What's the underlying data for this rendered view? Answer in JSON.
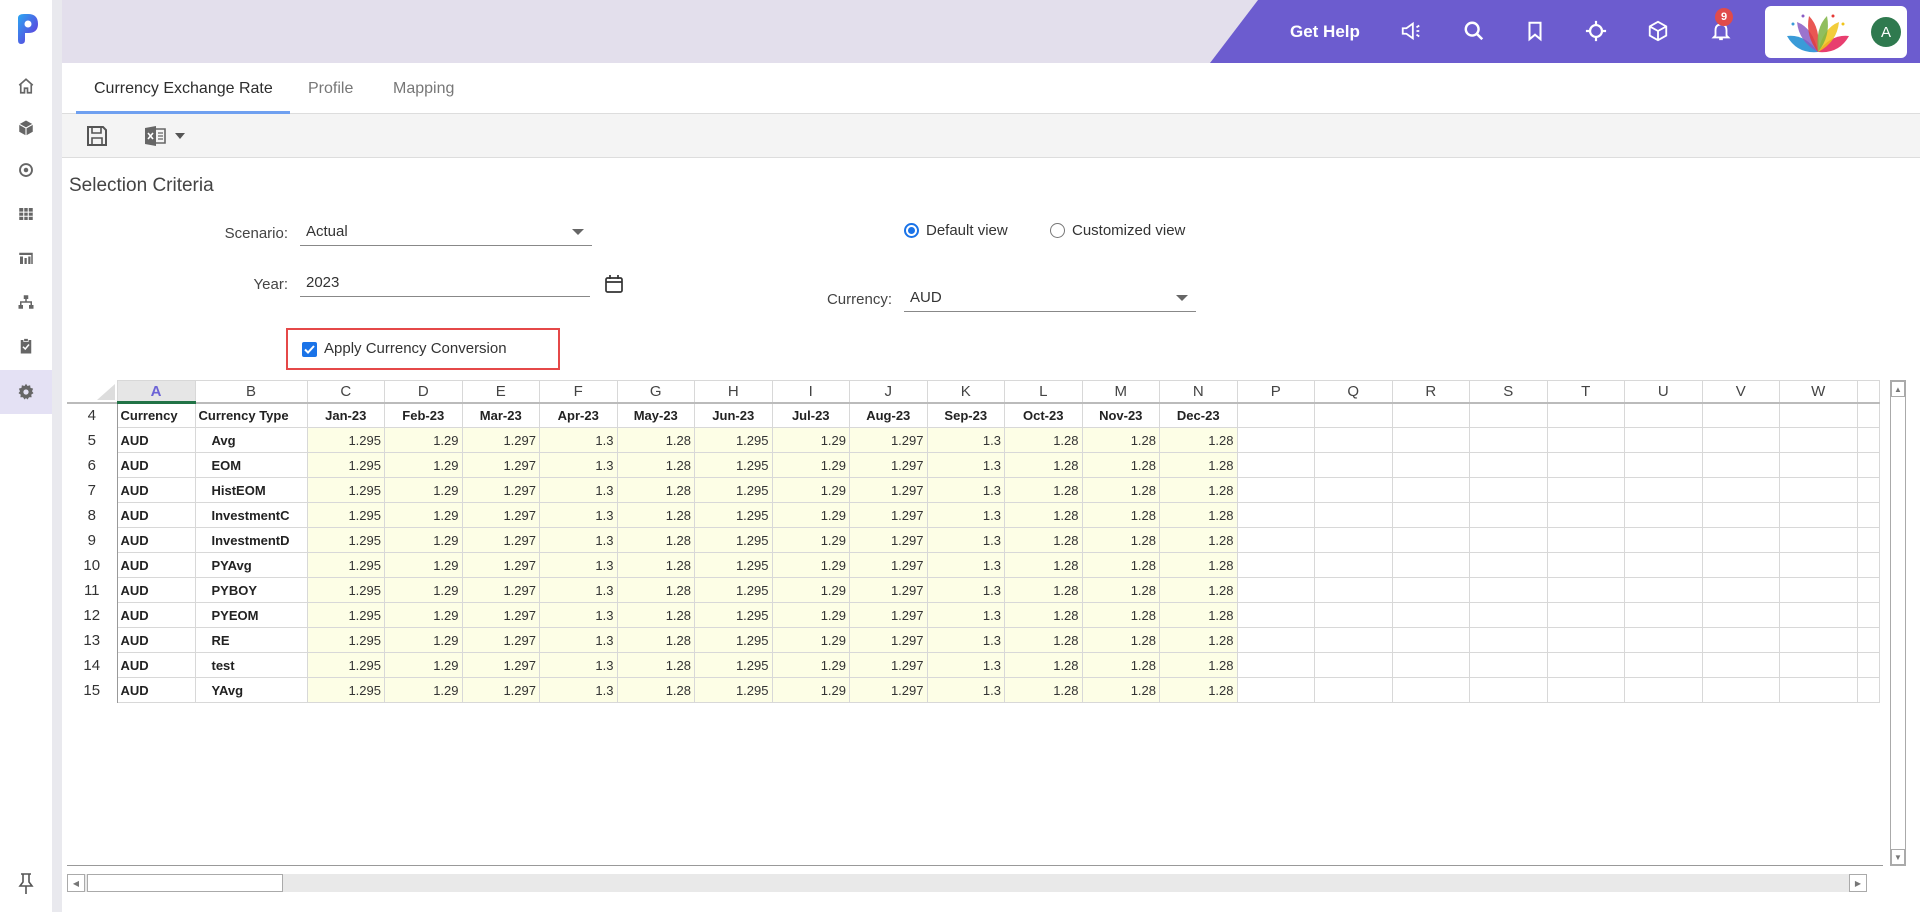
{
  "sidebar": {
    "items": [
      {
        "name": "home",
        "active": false
      },
      {
        "name": "cube",
        "active": false
      },
      {
        "name": "target",
        "active": false
      },
      {
        "name": "grid",
        "active": false
      },
      {
        "name": "report",
        "active": false
      },
      {
        "name": "hierarchy",
        "active": false
      },
      {
        "name": "clipboard-check",
        "active": false
      },
      {
        "name": "settings",
        "active": true
      }
    ]
  },
  "topbar": {
    "get_help": "Get Help",
    "notifications_count": "9",
    "avatar_initial": "A",
    "accent_color": "#6c5ccf"
  },
  "tabs": [
    {
      "label": "Currency Exchange Rate",
      "active": true
    },
    {
      "label": "Profile",
      "active": false
    },
    {
      "label": "Mapping",
      "active": false
    }
  ],
  "selection": {
    "title": "Selection Criteria",
    "scenario_label": "Scenario:",
    "scenario_value": "Actual",
    "year_label": "Year:",
    "year_value": "2023",
    "apply_conversion_label": "Apply Currency Conversion",
    "apply_conversion_checked": true,
    "default_view_label": "Default view",
    "customized_view_label": "Customized view",
    "selected_view": "Default view",
    "currency_label": "Currency:",
    "currency_value": "AUD"
  },
  "grid": {
    "column_letters": [
      "A",
      "B",
      "C",
      "D",
      "E",
      "F",
      "G",
      "H",
      "I",
      "J",
      "K",
      "L",
      "M",
      "N",
      "P",
      "Q",
      "R",
      "S",
      "T",
      "U",
      "V",
      "W"
    ],
    "selected_column": "A",
    "header_row_number": "4",
    "headers": [
      "Currency",
      "Currency Type",
      "Jan-23",
      "Feb-23",
      "Mar-23",
      "Apr-23",
      "May-23",
      "Jun-23",
      "Jul-23",
      "Aug-23",
      "Sep-23",
      "Oct-23",
      "Nov-23",
      "Dec-23"
    ],
    "rows": [
      {
        "row": "5",
        "currency": "AUD",
        "type": "Avg",
        "values": [
          "1.295",
          "1.29",
          "1.297",
          "1.3",
          "1.28",
          "1.295",
          "1.29",
          "1.297",
          "1.3",
          "1.28",
          "1.28",
          "1.28"
        ]
      },
      {
        "row": "6",
        "currency": "AUD",
        "type": "EOM",
        "values": [
          "1.295",
          "1.29",
          "1.297",
          "1.3",
          "1.28",
          "1.295",
          "1.29",
          "1.297",
          "1.3",
          "1.28",
          "1.28",
          "1.28"
        ]
      },
      {
        "row": "7",
        "currency": "AUD",
        "type": "HistEOM",
        "values": [
          "1.295",
          "1.29",
          "1.297",
          "1.3",
          "1.28",
          "1.295",
          "1.29",
          "1.297",
          "1.3",
          "1.28",
          "1.28",
          "1.28"
        ]
      },
      {
        "row": "8",
        "currency": "AUD",
        "type": "InvestmentC",
        "values": [
          "1.295",
          "1.29",
          "1.297",
          "1.3",
          "1.28",
          "1.295",
          "1.29",
          "1.297",
          "1.3",
          "1.28",
          "1.28",
          "1.28"
        ]
      },
      {
        "row": "9",
        "currency": "AUD",
        "type": "InvestmentD",
        "values": [
          "1.295",
          "1.29",
          "1.297",
          "1.3",
          "1.28",
          "1.295",
          "1.29",
          "1.297",
          "1.3",
          "1.28",
          "1.28",
          "1.28"
        ]
      },
      {
        "row": "10",
        "currency": "AUD",
        "type": "PYAvg",
        "values": [
          "1.295",
          "1.29",
          "1.297",
          "1.3",
          "1.28",
          "1.295",
          "1.29",
          "1.297",
          "1.3",
          "1.28",
          "1.28",
          "1.28"
        ]
      },
      {
        "row": "11",
        "currency": "AUD",
        "type": "PYBOY",
        "values": [
          "1.295",
          "1.29",
          "1.297",
          "1.3",
          "1.28",
          "1.295",
          "1.29",
          "1.297",
          "1.3",
          "1.28",
          "1.28",
          "1.28"
        ]
      },
      {
        "row": "12",
        "currency": "AUD",
        "type": "PYEOM",
        "values": [
          "1.295",
          "1.29",
          "1.297",
          "1.3",
          "1.28",
          "1.295",
          "1.29",
          "1.297",
          "1.3",
          "1.28",
          "1.28",
          "1.28"
        ]
      },
      {
        "row": "13",
        "currency": "AUD",
        "type": "RE",
        "values": [
          "1.295",
          "1.29",
          "1.297",
          "1.3",
          "1.28",
          "1.295",
          "1.29",
          "1.297",
          "1.3",
          "1.28",
          "1.28",
          "1.28"
        ]
      },
      {
        "row": "14",
        "currency": "AUD",
        "type": "test",
        "values": [
          "1.295",
          "1.29",
          "1.297",
          "1.3",
          "1.28",
          "1.295",
          "1.29",
          "1.297",
          "1.3",
          "1.28",
          "1.28",
          "1.28"
        ]
      },
      {
        "row": "15",
        "currency": "AUD",
        "type": "YAvg",
        "values": [
          "1.295",
          "1.29",
          "1.297",
          "1.3",
          "1.28",
          "1.295",
          "1.29",
          "1.297",
          "1.3",
          "1.28",
          "1.28",
          "1.28"
        ]
      }
    ]
  }
}
